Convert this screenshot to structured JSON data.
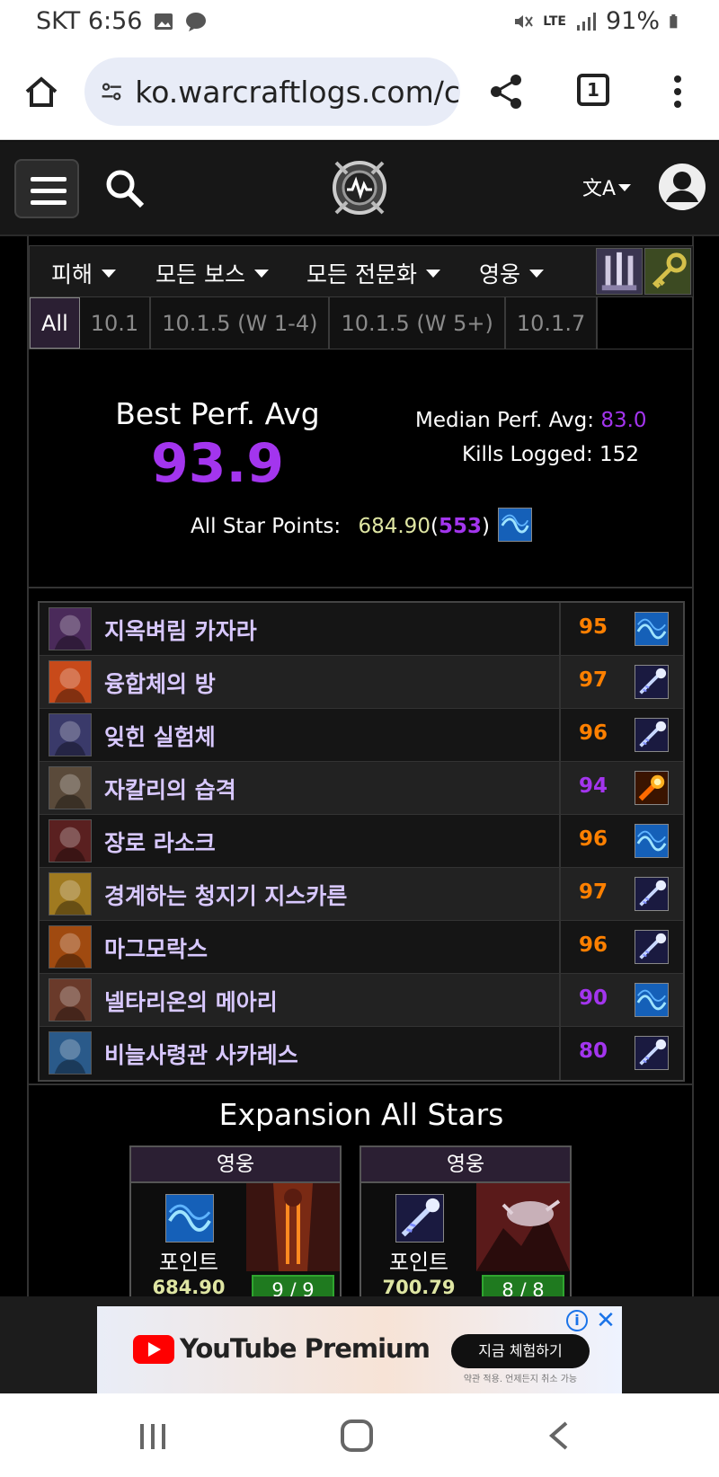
{
  "status_bar": {
    "carrier_time": "SKT 6:56",
    "network": "LTE",
    "battery": "91%"
  },
  "browser": {
    "url": "ko.warcraftlogs.com/c",
    "tab_count": "1"
  },
  "filters": {
    "items": [
      {
        "label": "피해"
      },
      {
        "label": "모든 보스"
      },
      {
        "label": "모든 전문화"
      },
      {
        "label": "영웅"
      }
    ]
  },
  "tabs": [
    "All",
    "10.1",
    "10.1.5 (W 1-4)",
    "10.1.5 (W 5+)",
    "10.1.7"
  ],
  "summary": {
    "best_perf_label": "Best Perf. Avg",
    "best_perf_value": "93.9",
    "median_label": "Median Perf. Avg:",
    "median_value": "83.0",
    "kills_label": "Kills Logged:",
    "kills_value": "152",
    "allstar_label": "All Star Points:",
    "allstar_points": "684.90",
    "allstar_rank": "553",
    "allstar_paren_open": "(",
    "allstar_paren_close": ")"
  },
  "bosses": [
    {
      "name": "지옥벼림 카자라",
      "score": "95",
      "score_color": "#ff8000",
      "spec_icon": "arcane-wave-icon"
    },
    {
      "name": "융합체의 방",
      "score": "97",
      "score_color": "#ff8000",
      "spec_icon": "frost-bolt-icon"
    },
    {
      "name": "잊힌 실험체",
      "score": "96",
      "score_color": "#ff8000",
      "spec_icon": "frost-bolt-icon"
    },
    {
      "name": "자칼리의 습격",
      "score": "94",
      "score_color": "#a335ee",
      "spec_icon": "fireball-icon"
    },
    {
      "name": "장로 라소크",
      "score": "96",
      "score_color": "#ff8000",
      "spec_icon": "arcane-wave-icon"
    },
    {
      "name": "경계하는 청지기 지스카른",
      "score": "97",
      "score_color": "#ff8000",
      "spec_icon": "frost-bolt-icon"
    },
    {
      "name": "마그모락스",
      "score": "96",
      "score_color": "#ff8000",
      "spec_icon": "frost-bolt-icon"
    },
    {
      "name": "넬타리온의 메아리",
      "score": "90",
      "score_color": "#a335ee",
      "spec_icon": "arcane-wave-icon"
    },
    {
      "name": "비늘사령관 사카레스",
      "score": "80",
      "score_color": "#a335ee",
      "spec_icon": "frost-bolt-icon"
    }
  ],
  "expansion": {
    "title": "Expansion All Stars",
    "cards": [
      {
        "difficulty": "영웅",
        "label": "포인트",
        "points": "684.90",
        "progress": "9 / 9",
        "spec_icon": "arcane-wave-icon"
      },
      {
        "difficulty": "영웅",
        "label": "포인트",
        "points": "700.79",
        "progress": "8 / 8",
        "spec_icon": "frost-bolt-icon"
      }
    ]
  },
  "ad": {
    "brand": "YouTube Premium",
    "cta": "지금 체험하기",
    "fine_print": "약관 적용. 언제든지 취소 가능"
  }
}
